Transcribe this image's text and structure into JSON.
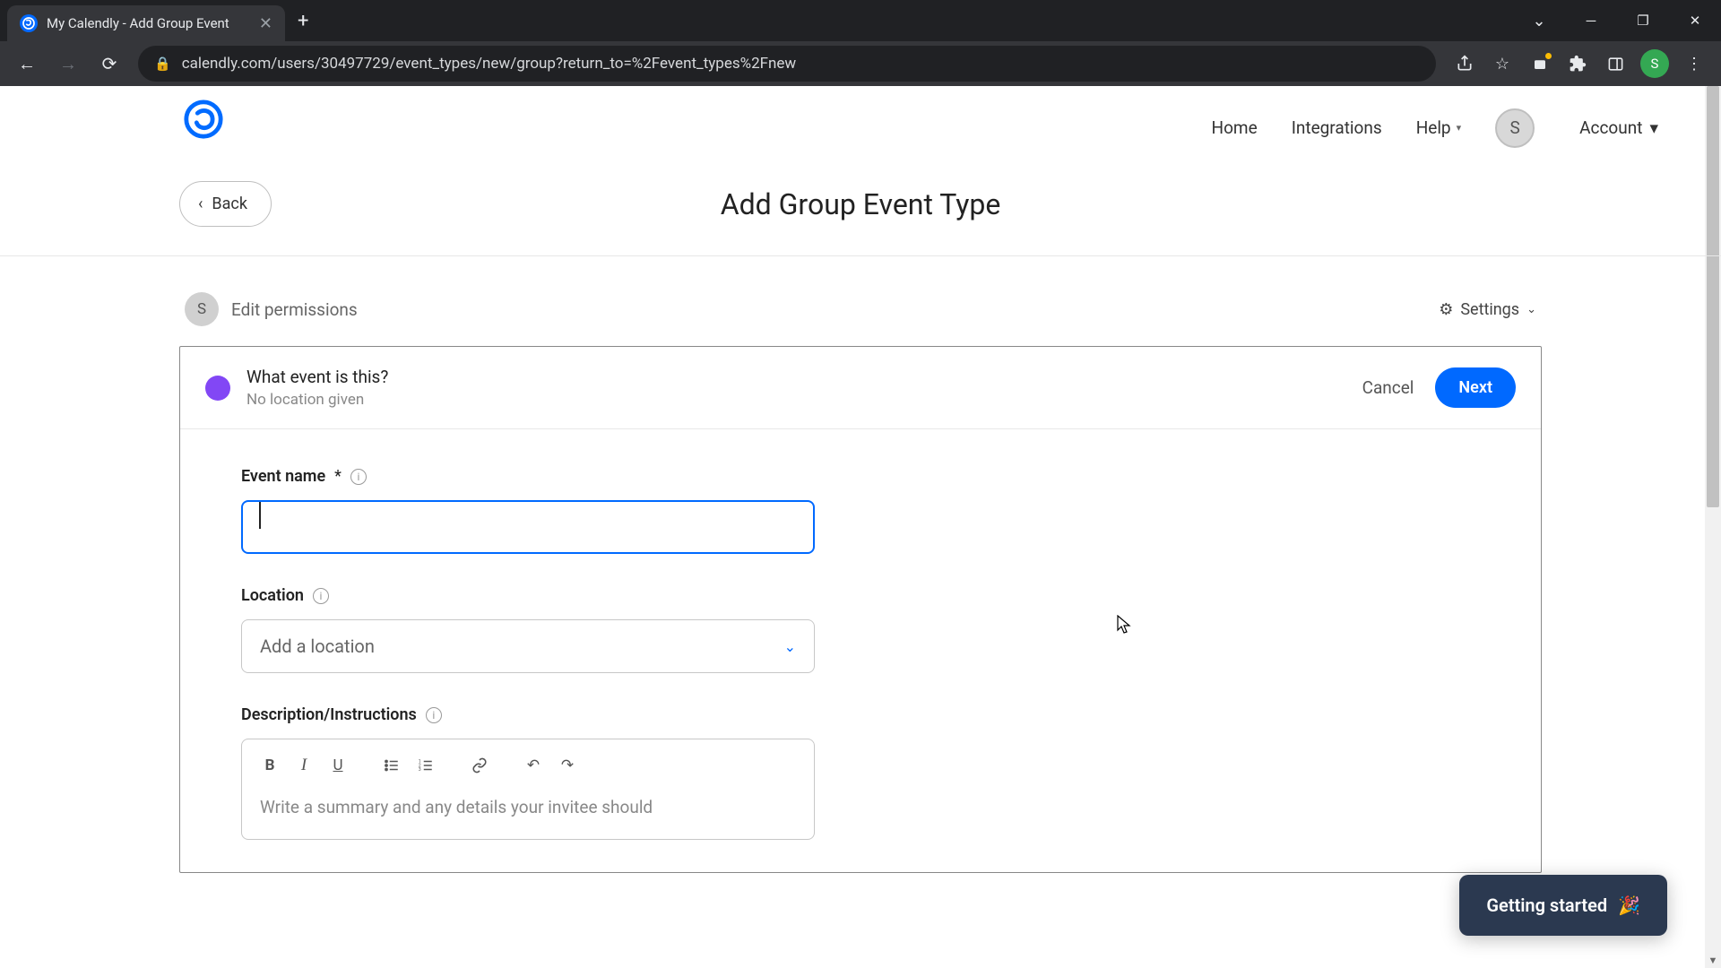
{
  "browser": {
    "tab_title": "My Calendly - Add Group Event",
    "url": "calendly.com/users/30497729/event_types/new/group?return_to=%2Fevent_types%2Fnew",
    "profile_initial": "S"
  },
  "nav": {
    "home": "Home",
    "integrations": "Integrations",
    "help": "Help",
    "account": "Account",
    "avatar_initial": "S"
  },
  "header": {
    "back": "Back",
    "title": "Add Group Event Type"
  },
  "permissions": {
    "avatar_initial": "S",
    "label": "Edit permissions",
    "settings": "Settings"
  },
  "card": {
    "question": "What event is this?",
    "subtitle": "No location given",
    "cancel": "Cancel",
    "next": "Next"
  },
  "form": {
    "event_name_label": "Event name",
    "required_mark": "*",
    "event_name_value": "",
    "location_label": "Location",
    "location_placeholder": "Add a location",
    "description_label": "Description/Instructions",
    "description_placeholder": "Write a summary and any details your invitee should",
    "color": "#8247f5"
  },
  "widget": {
    "getting_started": "Getting started"
  }
}
